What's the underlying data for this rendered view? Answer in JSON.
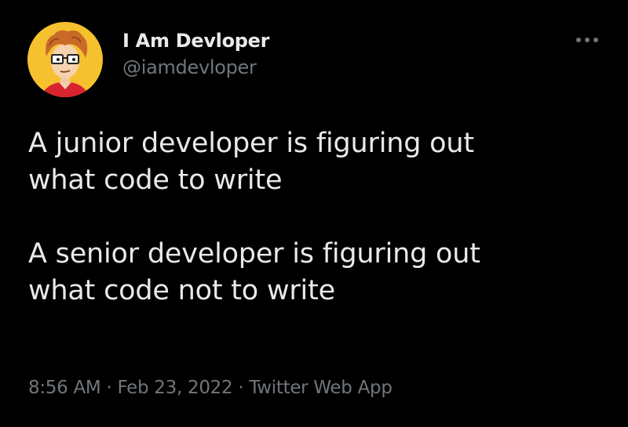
{
  "author": {
    "display_name": "I Am Devloper",
    "handle": "@iamdevloper",
    "avatar_icon": "cartoon-developer-avatar"
  },
  "more_icon": "ellipsis-icon",
  "tweet": {
    "paragraphs": [
      "A junior developer is figuring out\nwhat code to write",
      "A senior developer is figuring out\nwhat code not to write"
    ]
  },
  "meta": {
    "time": "8:56 AM",
    "separator": "·",
    "date": "Feb 23, 2022",
    "source": "Twitter Web App"
  },
  "colors": {
    "background": "#000000",
    "primary_text": "#e7e9ea",
    "secondary_text": "#71767b",
    "avatar_bg": "#f6c12f"
  }
}
